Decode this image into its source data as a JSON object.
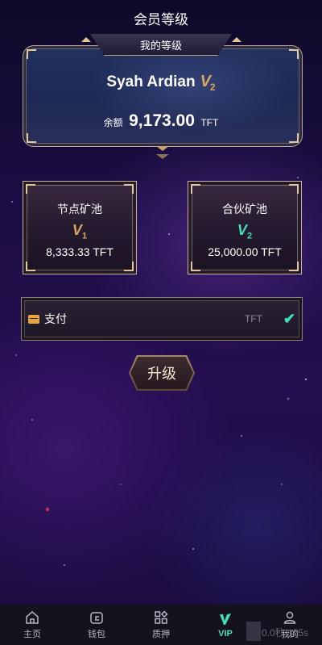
{
  "header": {
    "title": "会员等级"
  },
  "level_card": {
    "tab_label": "我的等级",
    "user_name": "Syah Ardian",
    "level_badge": {
      "letter": "V",
      "number": "2"
    },
    "balance_label": "余额",
    "balance_value": "9,173.00",
    "balance_unit": "TFT"
  },
  "pools": [
    {
      "title": "节点矿池",
      "badge_letter": "V",
      "badge_number": "1",
      "badge_color": "#d6a75a",
      "amount": "8,333.33 TFT"
    },
    {
      "title": "合伙矿池",
      "badge_letter": "V",
      "badge_number": "2",
      "badge_color": "#3fe0b5",
      "amount": "25,000.00 TFT"
    }
  ],
  "payment": {
    "label": "支付",
    "unit": "TFT",
    "check_icon": "check-icon"
  },
  "upgrade_button": {
    "label": "升级"
  },
  "nav": {
    "items": [
      {
        "label": "主页",
        "icon": "home-icon"
      },
      {
        "label": "钱包",
        "icon": "wallet-icon"
      },
      {
        "label": "质押",
        "icon": "grid-icon"
      },
      {
        "label": "VIP",
        "icon": "vip-icon"
      },
      {
        "label": "我的",
        "icon": "user-icon"
      }
    ],
    "active": "VIP"
  },
  "overlay": {
    "text": "0.0秒 125s"
  },
  "colors": {
    "accent": "#3fe0b5",
    "gold": "#d6a75a",
    "frame": "#c9b396"
  }
}
